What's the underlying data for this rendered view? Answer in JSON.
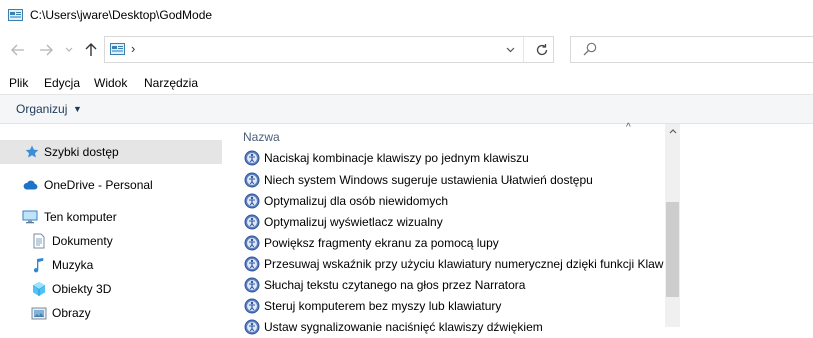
{
  "window": {
    "title": "C:\\Users\\jware\\Desktop\\GodMode"
  },
  "nav": {
    "back_icon": "arrow-left-icon",
    "forward_icon": "arrow-right-icon",
    "recent_icon": "chevron-down-icon",
    "up_icon": "arrow-up-icon",
    "address_separator": "›",
    "search_placeholder": ""
  },
  "menu": {
    "items": [
      "Plik",
      "Edycja",
      "Widok",
      "Narzędzia"
    ]
  },
  "command_bar": {
    "organize_label": "Organizuj"
  },
  "sidebar": {
    "items": [
      {
        "label": "Szybki dostęp",
        "icon": "star-icon",
        "selected": true
      },
      {
        "label": "OneDrive - Personal",
        "icon": "cloud-icon",
        "selected": false
      },
      {
        "label": "Ten komputer",
        "icon": "computer-icon",
        "selected": false
      },
      {
        "label": "Dokumenty",
        "icon": "document-icon",
        "selected": false
      },
      {
        "label": "Muzyka",
        "icon": "music-icon",
        "selected": false
      },
      {
        "label": "Obiekty 3D",
        "icon": "cube-icon",
        "selected": false
      },
      {
        "label": "Obrazy",
        "icon": "picture-icon",
        "selected": false
      }
    ]
  },
  "content": {
    "column_header": "Nazwa",
    "items": [
      "Naciskaj kombinacje klawiszy po jednym klawiszu",
      "Niech system Windows sugeruje ustawienia Ułatwień dostępu",
      "Optymalizuj dla osób niewidomych",
      "Optymalizuj wyświetlacz wizualny",
      "Powiększ fragmenty ekranu za pomocą lupy",
      "Przesuwaj wskaźnik przy użyciu klawiatury numerycznej dzięki funkcji Klawis",
      "Słuchaj tekstu czytanego na głos przez Narratora",
      "Steruj komputerem bez myszy lub klawiatury",
      "Ustaw sygnalizowanie naciśnięć klawiszy dźwiękiem"
    ]
  },
  "colors": {
    "accent": "#0078d7",
    "selected_bg": "#e5e5e5",
    "header_text": "#4c607a"
  }
}
